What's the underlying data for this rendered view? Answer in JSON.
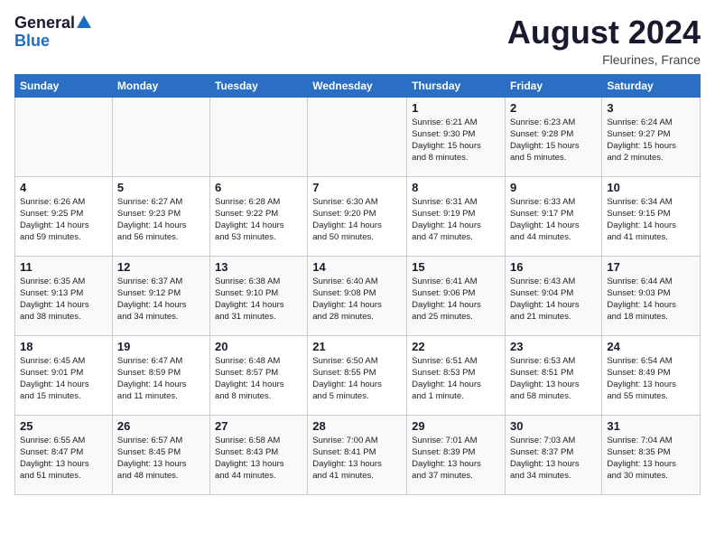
{
  "logo": {
    "general": "General",
    "blue": "Blue"
  },
  "title": "August 2024",
  "subtitle": "Fleurines, France",
  "days_of_week": [
    "Sunday",
    "Monday",
    "Tuesday",
    "Wednesday",
    "Thursday",
    "Friday",
    "Saturday"
  ],
  "weeks": [
    [
      {
        "num": "",
        "info": ""
      },
      {
        "num": "",
        "info": ""
      },
      {
        "num": "",
        "info": ""
      },
      {
        "num": "",
        "info": ""
      },
      {
        "num": "1",
        "info": "Sunrise: 6:21 AM\nSunset: 9:30 PM\nDaylight: 15 hours\nand 8 minutes."
      },
      {
        "num": "2",
        "info": "Sunrise: 6:23 AM\nSunset: 9:28 PM\nDaylight: 15 hours\nand 5 minutes."
      },
      {
        "num": "3",
        "info": "Sunrise: 6:24 AM\nSunset: 9:27 PM\nDaylight: 15 hours\nand 2 minutes."
      }
    ],
    [
      {
        "num": "4",
        "info": "Sunrise: 6:26 AM\nSunset: 9:25 PM\nDaylight: 14 hours\nand 59 minutes."
      },
      {
        "num": "5",
        "info": "Sunrise: 6:27 AM\nSunset: 9:23 PM\nDaylight: 14 hours\nand 56 minutes."
      },
      {
        "num": "6",
        "info": "Sunrise: 6:28 AM\nSunset: 9:22 PM\nDaylight: 14 hours\nand 53 minutes."
      },
      {
        "num": "7",
        "info": "Sunrise: 6:30 AM\nSunset: 9:20 PM\nDaylight: 14 hours\nand 50 minutes."
      },
      {
        "num": "8",
        "info": "Sunrise: 6:31 AM\nSunset: 9:19 PM\nDaylight: 14 hours\nand 47 minutes."
      },
      {
        "num": "9",
        "info": "Sunrise: 6:33 AM\nSunset: 9:17 PM\nDaylight: 14 hours\nand 44 minutes."
      },
      {
        "num": "10",
        "info": "Sunrise: 6:34 AM\nSunset: 9:15 PM\nDaylight: 14 hours\nand 41 minutes."
      }
    ],
    [
      {
        "num": "11",
        "info": "Sunrise: 6:35 AM\nSunset: 9:13 PM\nDaylight: 14 hours\nand 38 minutes."
      },
      {
        "num": "12",
        "info": "Sunrise: 6:37 AM\nSunset: 9:12 PM\nDaylight: 14 hours\nand 34 minutes."
      },
      {
        "num": "13",
        "info": "Sunrise: 6:38 AM\nSunset: 9:10 PM\nDaylight: 14 hours\nand 31 minutes."
      },
      {
        "num": "14",
        "info": "Sunrise: 6:40 AM\nSunset: 9:08 PM\nDaylight: 14 hours\nand 28 minutes."
      },
      {
        "num": "15",
        "info": "Sunrise: 6:41 AM\nSunset: 9:06 PM\nDaylight: 14 hours\nand 25 minutes."
      },
      {
        "num": "16",
        "info": "Sunrise: 6:43 AM\nSunset: 9:04 PM\nDaylight: 14 hours\nand 21 minutes."
      },
      {
        "num": "17",
        "info": "Sunrise: 6:44 AM\nSunset: 9:03 PM\nDaylight: 14 hours\nand 18 minutes."
      }
    ],
    [
      {
        "num": "18",
        "info": "Sunrise: 6:45 AM\nSunset: 9:01 PM\nDaylight: 14 hours\nand 15 minutes."
      },
      {
        "num": "19",
        "info": "Sunrise: 6:47 AM\nSunset: 8:59 PM\nDaylight: 14 hours\nand 11 minutes."
      },
      {
        "num": "20",
        "info": "Sunrise: 6:48 AM\nSunset: 8:57 PM\nDaylight: 14 hours\nand 8 minutes."
      },
      {
        "num": "21",
        "info": "Sunrise: 6:50 AM\nSunset: 8:55 PM\nDaylight: 14 hours\nand 5 minutes."
      },
      {
        "num": "22",
        "info": "Sunrise: 6:51 AM\nSunset: 8:53 PM\nDaylight: 14 hours\nand 1 minute."
      },
      {
        "num": "23",
        "info": "Sunrise: 6:53 AM\nSunset: 8:51 PM\nDaylight: 13 hours\nand 58 minutes."
      },
      {
        "num": "24",
        "info": "Sunrise: 6:54 AM\nSunset: 8:49 PM\nDaylight: 13 hours\nand 55 minutes."
      }
    ],
    [
      {
        "num": "25",
        "info": "Sunrise: 6:55 AM\nSunset: 8:47 PM\nDaylight: 13 hours\nand 51 minutes."
      },
      {
        "num": "26",
        "info": "Sunrise: 6:57 AM\nSunset: 8:45 PM\nDaylight: 13 hours\nand 48 minutes."
      },
      {
        "num": "27",
        "info": "Sunrise: 6:58 AM\nSunset: 8:43 PM\nDaylight: 13 hours\nand 44 minutes."
      },
      {
        "num": "28",
        "info": "Sunrise: 7:00 AM\nSunset: 8:41 PM\nDaylight: 13 hours\nand 41 minutes."
      },
      {
        "num": "29",
        "info": "Sunrise: 7:01 AM\nSunset: 8:39 PM\nDaylight: 13 hours\nand 37 minutes."
      },
      {
        "num": "30",
        "info": "Sunrise: 7:03 AM\nSunset: 8:37 PM\nDaylight: 13 hours\nand 34 minutes."
      },
      {
        "num": "31",
        "info": "Sunrise: 7:04 AM\nSunset: 8:35 PM\nDaylight: 13 hours\nand 30 minutes."
      }
    ]
  ]
}
